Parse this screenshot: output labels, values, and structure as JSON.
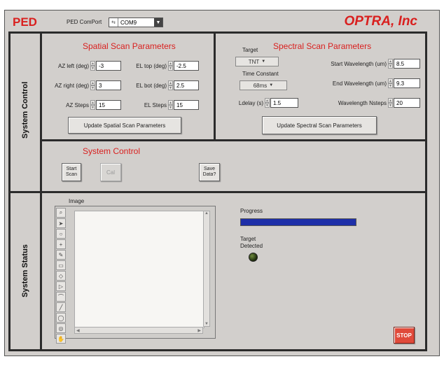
{
  "header": {
    "title": "PED",
    "comport_label": "PED ComPort",
    "comport_value": "COM9",
    "company": "OPTRA, Inc"
  },
  "sections": {
    "system_control": "System Control",
    "system_status": "System Status"
  },
  "spatial": {
    "heading": "Spatial Scan Parameters",
    "az_left_label": "AZ left (deg)",
    "az_left": "-3",
    "el_top_label": "EL top (deg)",
    "el_top": "-2.5",
    "az_right_label": "AZ right (deg)",
    "az_right": "3",
    "el_bot_label": "EL bot (deg)",
    "el_bot": "2.5",
    "az_steps_label": "AZ Steps",
    "az_steps": "15",
    "el_steps_label": "EL Steps",
    "el_steps": "15",
    "update_button": "Update Spatial Scan Parameters"
  },
  "spectral": {
    "heading": "Spectral Scan Parameters",
    "target_label": "Target",
    "target_value": "TNT",
    "time_constant_label": "Time Constant",
    "time_constant_value": "68ms",
    "ldelay_label": "Ldelay (s)",
    "ldelay": "1.5",
    "start_wl_label": "Start Wavelength (um)",
    "start_wl": "8.5",
    "end_wl_label": "End Wavelength (um)",
    "end_wl": "9.3",
    "nsteps_label": "Wavelength Nsteps",
    "nsteps": "20",
    "update_button": "Update Spectral Scan Parameters"
  },
  "control": {
    "heading": "System Control",
    "start_scan": "Start Scan",
    "cal": "Cal",
    "save_data": "Save Data?"
  },
  "status": {
    "image_label": "Image",
    "progress_label": "Progress",
    "progress_value": 1.0,
    "target_detected_label": "Target Detected",
    "stop_button": "STOP"
  },
  "colors": {
    "accent_red": "#d9201f",
    "progress_blue": "#1e2fa8",
    "panel_gray": "#d2cfcc"
  },
  "icons": [
    "zoom-icon",
    "pointer-icon",
    "pan-icon",
    "crosshair-icon",
    "pencil-icon",
    "rectangle-icon",
    "ellipse-icon",
    "polygon-icon",
    "freehand-icon",
    "line-icon",
    "oval-icon",
    "annulus-icon",
    "hand-icon"
  ]
}
